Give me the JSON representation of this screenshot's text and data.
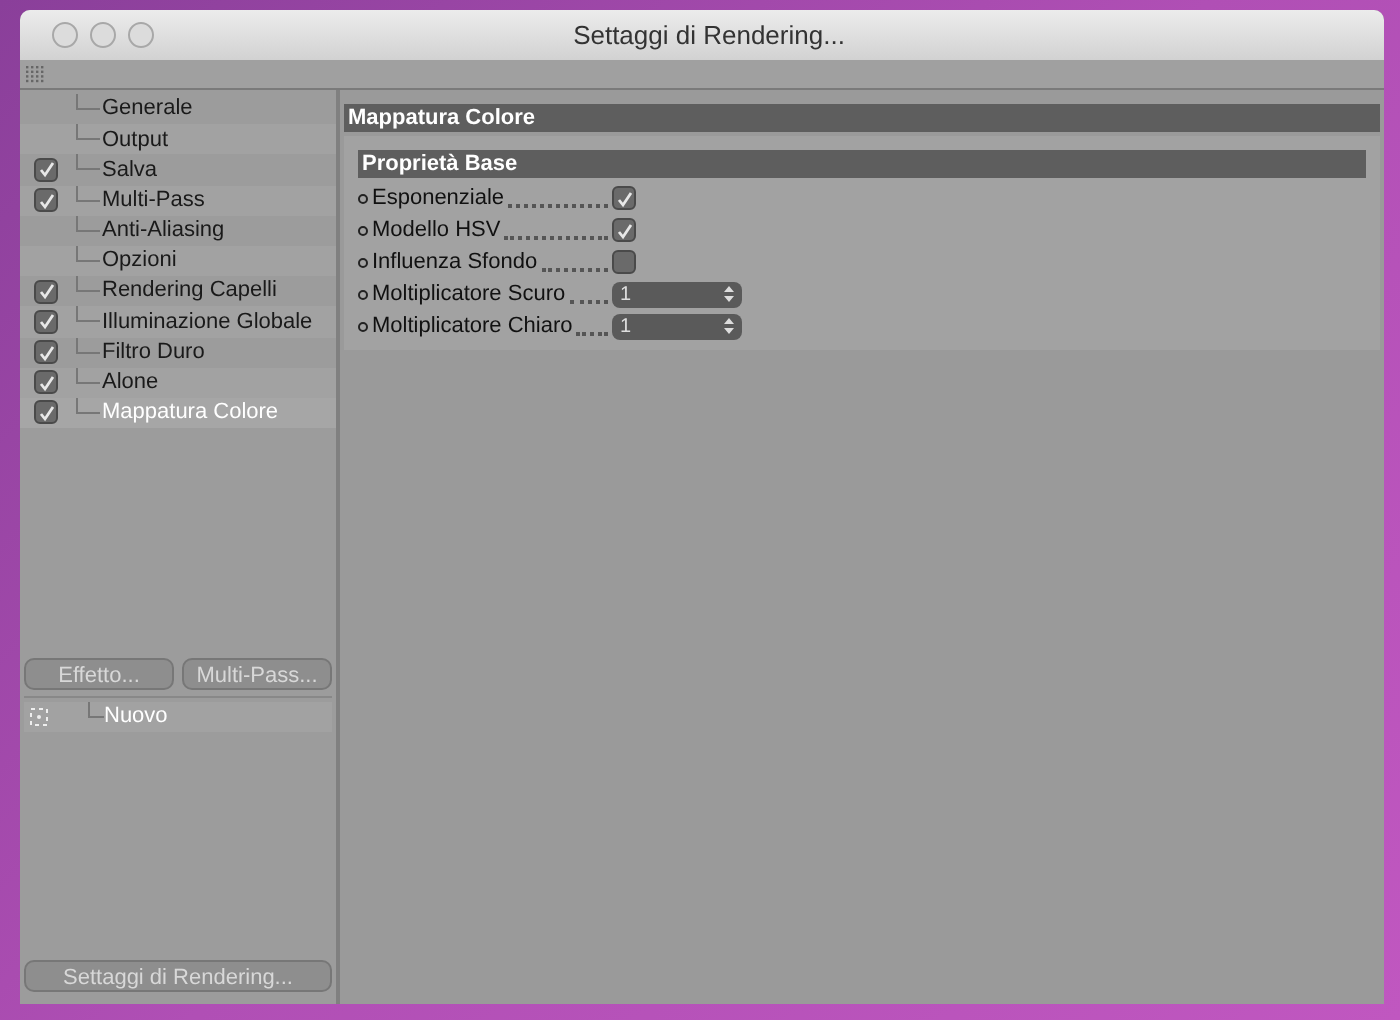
{
  "window": {
    "title": "Settaggi di Rendering..."
  },
  "sidebar": {
    "items": [
      {
        "label": "Generale",
        "checked": false,
        "selected": false
      },
      {
        "label": "Output",
        "checked": false,
        "selected": false
      },
      {
        "label": "Salva",
        "checked": true,
        "selected": false
      },
      {
        "label": "Multi-Pass",
        "checked": true,
        "selected": false
      },
      {
        "label": "Anti-Aliasing",
        "checked": false,
        "selected": false
      },
      {
        "label": "Opzioni",
        "checked": false,
        "selected": false
      },
      {
        "label": "Rendering Capelli",
        "checked": true,
        "selected": false
      },
      {
        "label": "Illuminazione Globale",
        "checked": true,
        "selected": false
      },
      {
        "label": "Filtro Duro",
        "checked": true,
        "selected": false
      },
      {
        "label": "Alone",
        "checked": true,
        "selected": false
      },
      {
        "label": "Mappatura Colore",
        "checked": true,
        "selected": true
      }
    ],
    "buttons": [
      "Effetto...",
      "Multi-Pass..."
    ],
    "presets": [
      {
        "label": "Nuovo"
      }
    ],
    "footer_button": "Settaggi di Rendering..."
  },
  "panel": {
    "title": "Mappatura Colore",
    "group": {
      "title": "Proprietà Base",
      "fields": [
        {
          "kind": "checkbox",
          "label": "Esponenziale",
          "checked": true
        },
        {
          "kind": "checkbox",
          "label": "Modello HSV",
          "checked": true
        },
        {
          "kind": "checkbox",
          "label": "Influenza Sfondo",
          "checked": false
        },
        {
          "kind": "number",
          "label": "Moltiplicatore Scuro",
          "value": "1"
        },
        {
          "kind": "number",
          "label": "Moltiplicatore Chiaro",
          "value": "1"
        }
      ]
    }
  }
}
